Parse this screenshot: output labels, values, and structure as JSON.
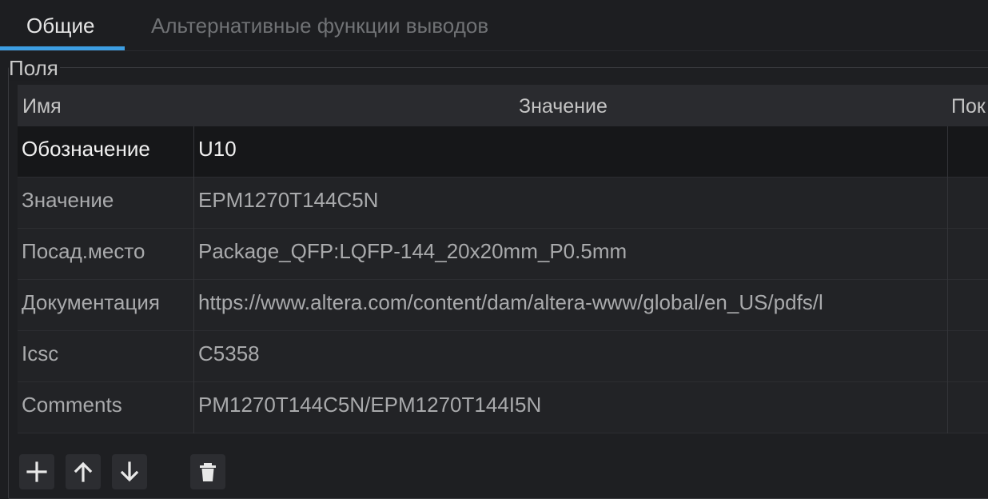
{
  "tabs": [
    {
      "label": "Общие",
      "active": true
    },
    {
      "label": "Альтернативные функции выводов",
      "active": false
    }
  ],
  "group": {
    "title": "Поля"
  },
  "table": {
    "columns": [
      "Имя",
      "Значение",
      "Пок"
    ],
    "rows": [
      {
        "name": "Обозначение",
        "value": "U10",
        "selected": true
      },
      {
        "name": "Значение",
        "value": "EPM1270T144C5N"
      },
      {
        "name": "Посад.место",
        "value": "Package_QFP:LQFP-144_20x20mm_P0.5mm"
      },
      {
        "name": "Документация",
        "value": "https://www.altera.com/content/dam/altera-www/global/en_US/pdfs/l"
      },
      {
        "name": "Icsc",
        "value": "C5358"
      },
      {
        "name": "Comments",
        "value": "PM1270T144C5N/EPM1270T144I5N"
      }
    ]
  },
  "toolbar": {
    "icons": [
      "plus-icon",
      "arrow-up-icon",
      "arrow-down-icon",
      "trash-icon"
    ]
  },
  "colors": {
    "accent": "#3d9ee2",
    "background": "#1d1e21",
    "selected_row": "#161719"
  }
}
